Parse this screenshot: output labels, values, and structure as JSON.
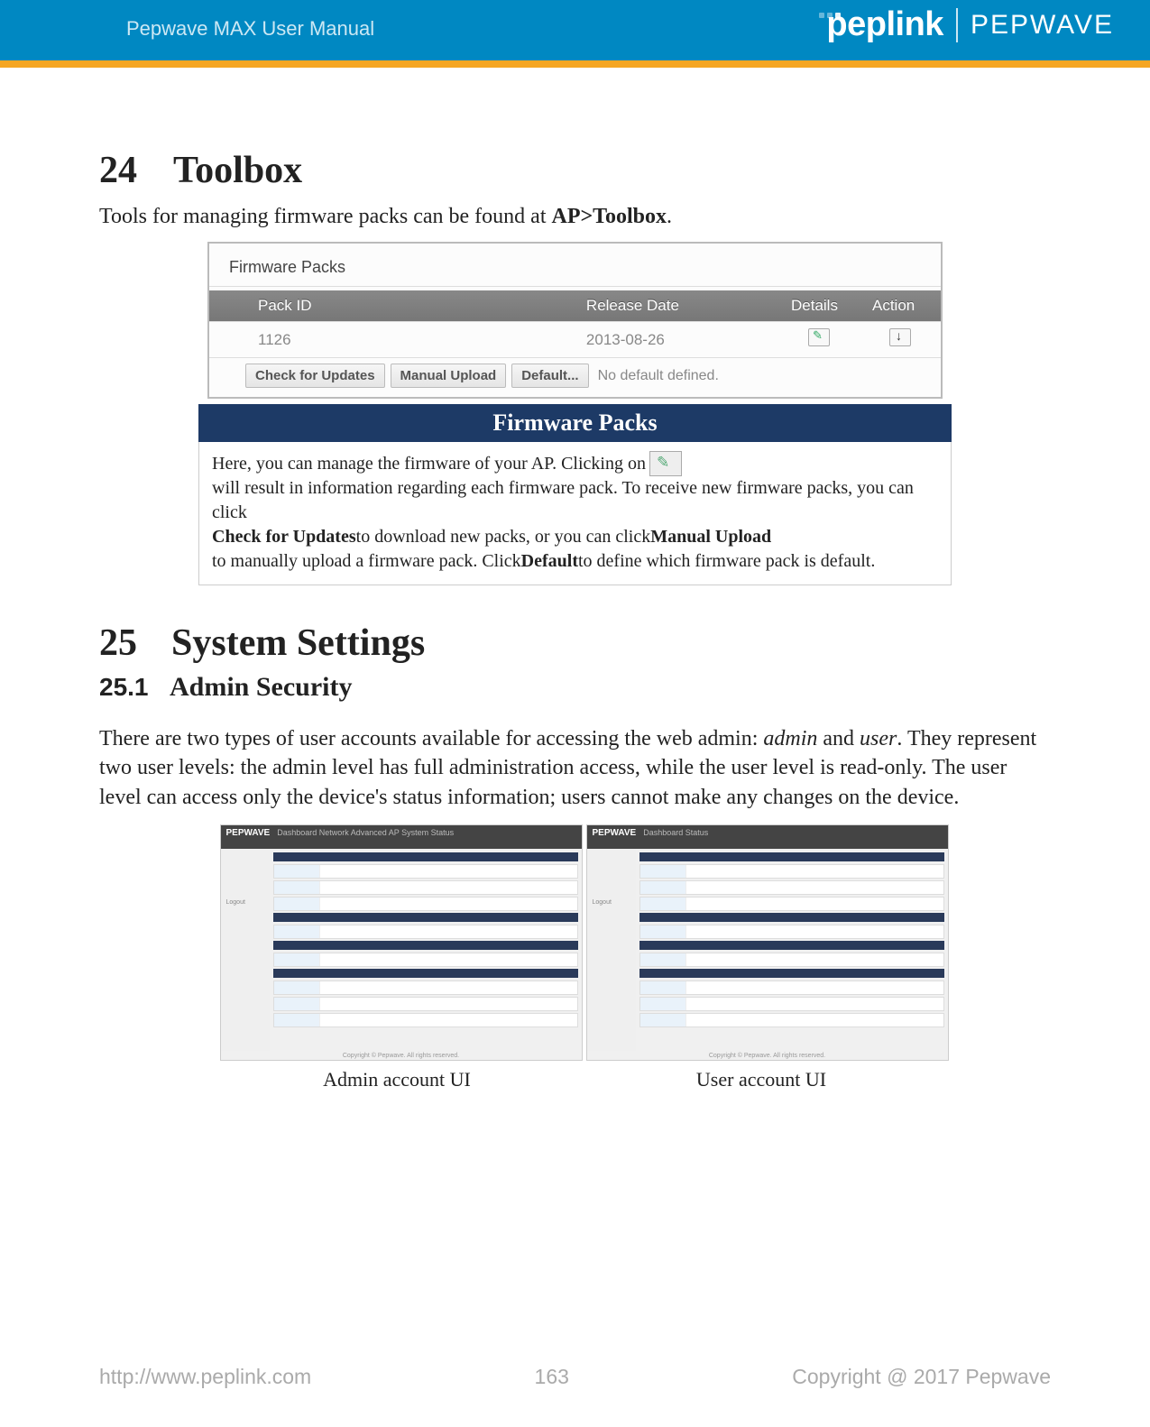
{
  "header": {
    "manual_title": "Pepwave MAX User Manual",
    "brand1": "peplink",
    "brand2": "PEPWAVE"
  },
  "section24": {
    "num": "24",
    "title": "Toolbox",
    "intro_prefix": "Tools for managing firmware packs can be found at ",
    "intro_bold": "AP>Toolbox",
    "intro_suffix": "."
  },
  "firmware_ui": {
    "panel_title": "Firmware Packs",
    "cols": {
      "id": "Pack ID",
      "date": "Release Date",
      "details": "Details",
      "action": "Action"
    },
    "row": {
      "id": "1126",
      "date": "2013-08-26"
    },
    "btn_check": "Check for Updates",
    "btn_upload": "Manual Upload",
    "btn_default": "Default...",
    "status": "No default defined."
  },
  "info": {
    "title": "Firmware Packs",
    "p1a": "Here, you can manage the firmware of your AP. Clicking on",
    "p1b": "will result in information regarding each firmware pack. To receive new firmware packs, you can click ",
    "b1": "Check for Updates",
    "p1c": " to download new packs, or you can click ",
    "b2": "Manual Upload",
    "p1d": " to manually upload a firmware pack. Click ",
    "b3": "Default",
    "p1e": " to define which firmware pack is default."
  },
  "section25": {
    "num": "25",
    "title": "System Settings",
    "sub_num": "25.1",
    "sub_title": "Admin Security",
    "body_a": "There are two types of user accounts available for accessing the web admin: ",
    "body_i1": "admin",
    "body_mid": " and ",
    "body_i2": "user",
    "body_b": ". They represent two user levels: the admin level has full administration access, while the user level is read-only. The user level can access only the device's status information; users cannot make any changes on the device."
  },
  "captions": {
    "admin": "Admin account UI",
    "user": "User account UI"
  },
  "footer": {
    "url": "http://www.peplink.com",
    "page": "163",
    "copy": "Copyright @ 2017 Pepwave"
  },
  "mini_nav": {
    "logo": "PEPWAVE",
    "items_admin": "Dashboard  Network  Advanced  AP  System  Status",
    "items_user": "Dashboard  Status",
    "logout": "Logout"
  }
}
